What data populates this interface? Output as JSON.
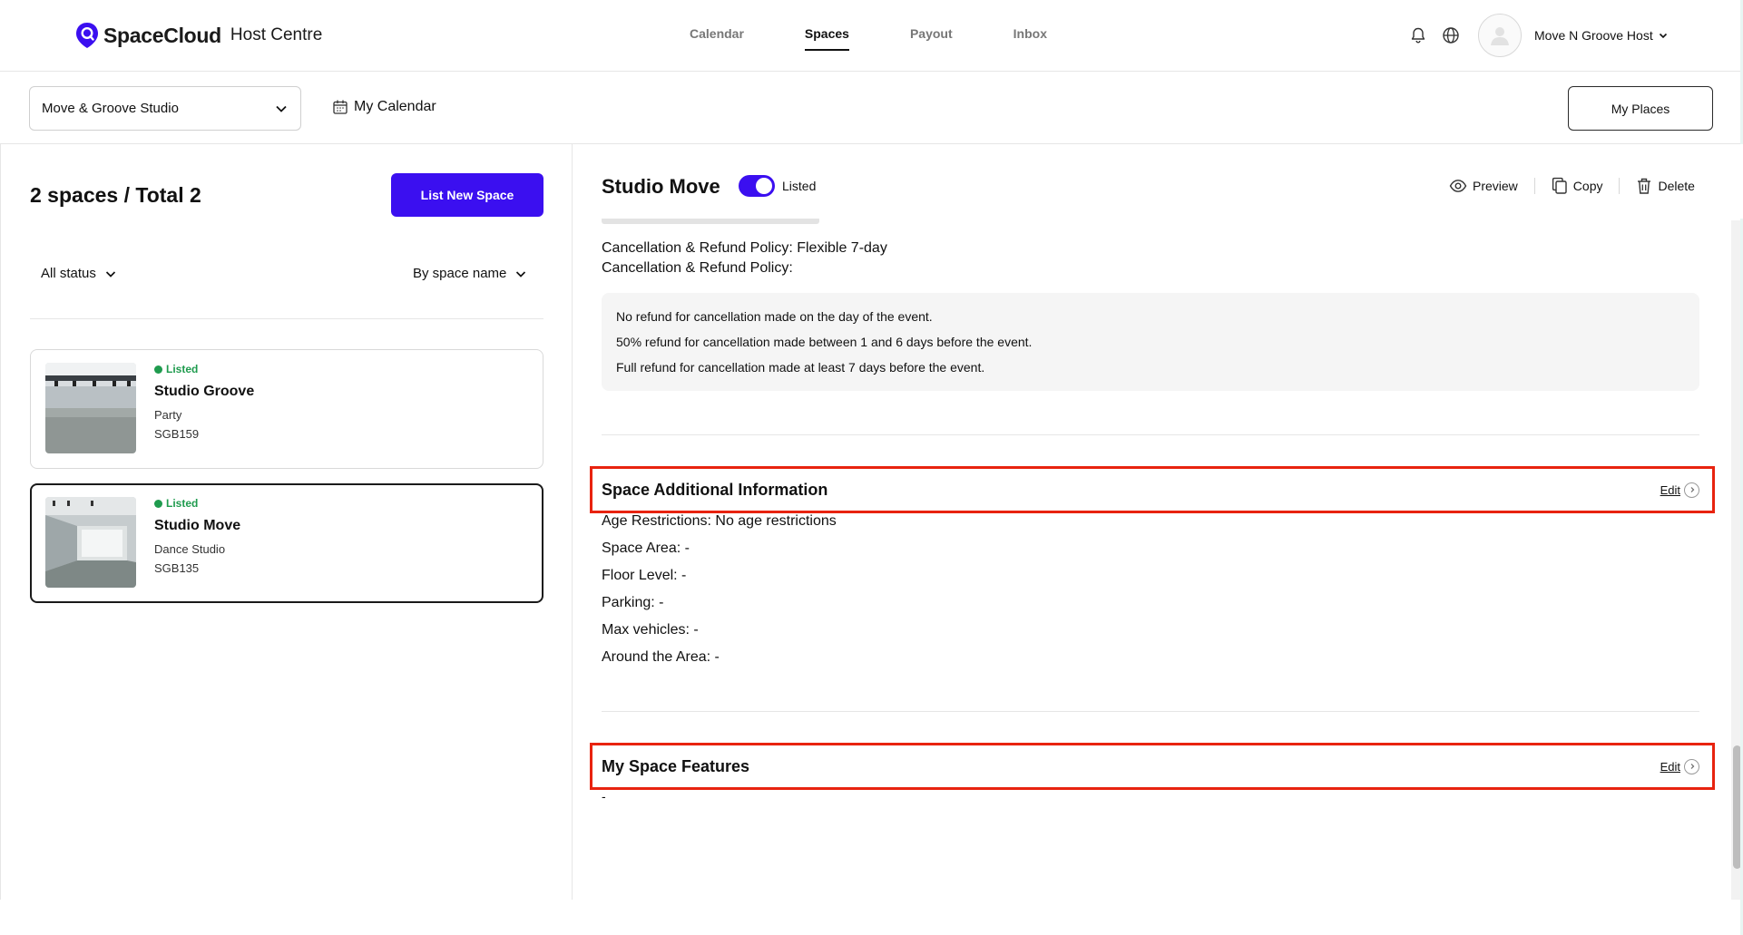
{
  "header": {
    "brand": "SpaceCloud",
    "brand_sub": "Host Centre",
    "nav": [
      "Calendar",
      "Spaces",
      "Payout",
      "Inbox"
    ],
    "active_nav": "Spaces",
    "user_name": "Move N Groove Host"
  },
  "subbar": {
    "venue": "Move & Groove Studio",
    "my_calendar": "My Calendar",
    "my_places": "My Places"
  },
  "sidebar": {
    "count_label": "2 spaces / Total 2",
    "list_new_label": "List New Space",
    "status_filter": "All status",
    "sort_filter": "By space name",
    "spaces": [
      {
        "status": "Listed",
        "name": "Studio Groove",
        "type": "Party",
        "code": "SGB159",
        "selected": false
      },
      {
        "status": "Listed",
        "name": "Studio Move",
        "type": "Dance Studio",
        "code": "SGB135",
        "selected": true
      }
    ]
  },
  "detail": {
    "title": "Studio Move",
    "listed_label": "Listed",
    "listed_on": true,
    "actions": {
      "preview": "Preview",
      "copy": "Copy",
      "delete": "Delete"
    },
    "policy": {
      "line1": "Cancellation & Refund Policy: Flexible 7-day",
      "line2": "Cancellation & Refund Policy:",
      "items": [
        "No refund for cancellation made on the day of the event.",
        "50% refund for cancellation made between 1 and 6 days before the event.",
        "Full refund for cancellation made at least 7 days before the event."
      ]
    },
    "additional": {
      "title": "Space Additional Information",
      "edit": "Edit",
      "lines": [
        "Age Restrictions: No age restrictions",
        "Space Area: -",
        "Floor Level: -",
        "Parking: -",
        "Max vehicles: -",
        "Around the Area: -"
      ]
    },
    "features": {
      "title": "My Space Features",
      "edit": "Edit",
      "value": "-"
    }
  },
  "colors": {
    "accent": "#3b0ff0",
    "listed_green": "#1f9b4e",
    "highlight_red": "#e8230f"
  }
}
